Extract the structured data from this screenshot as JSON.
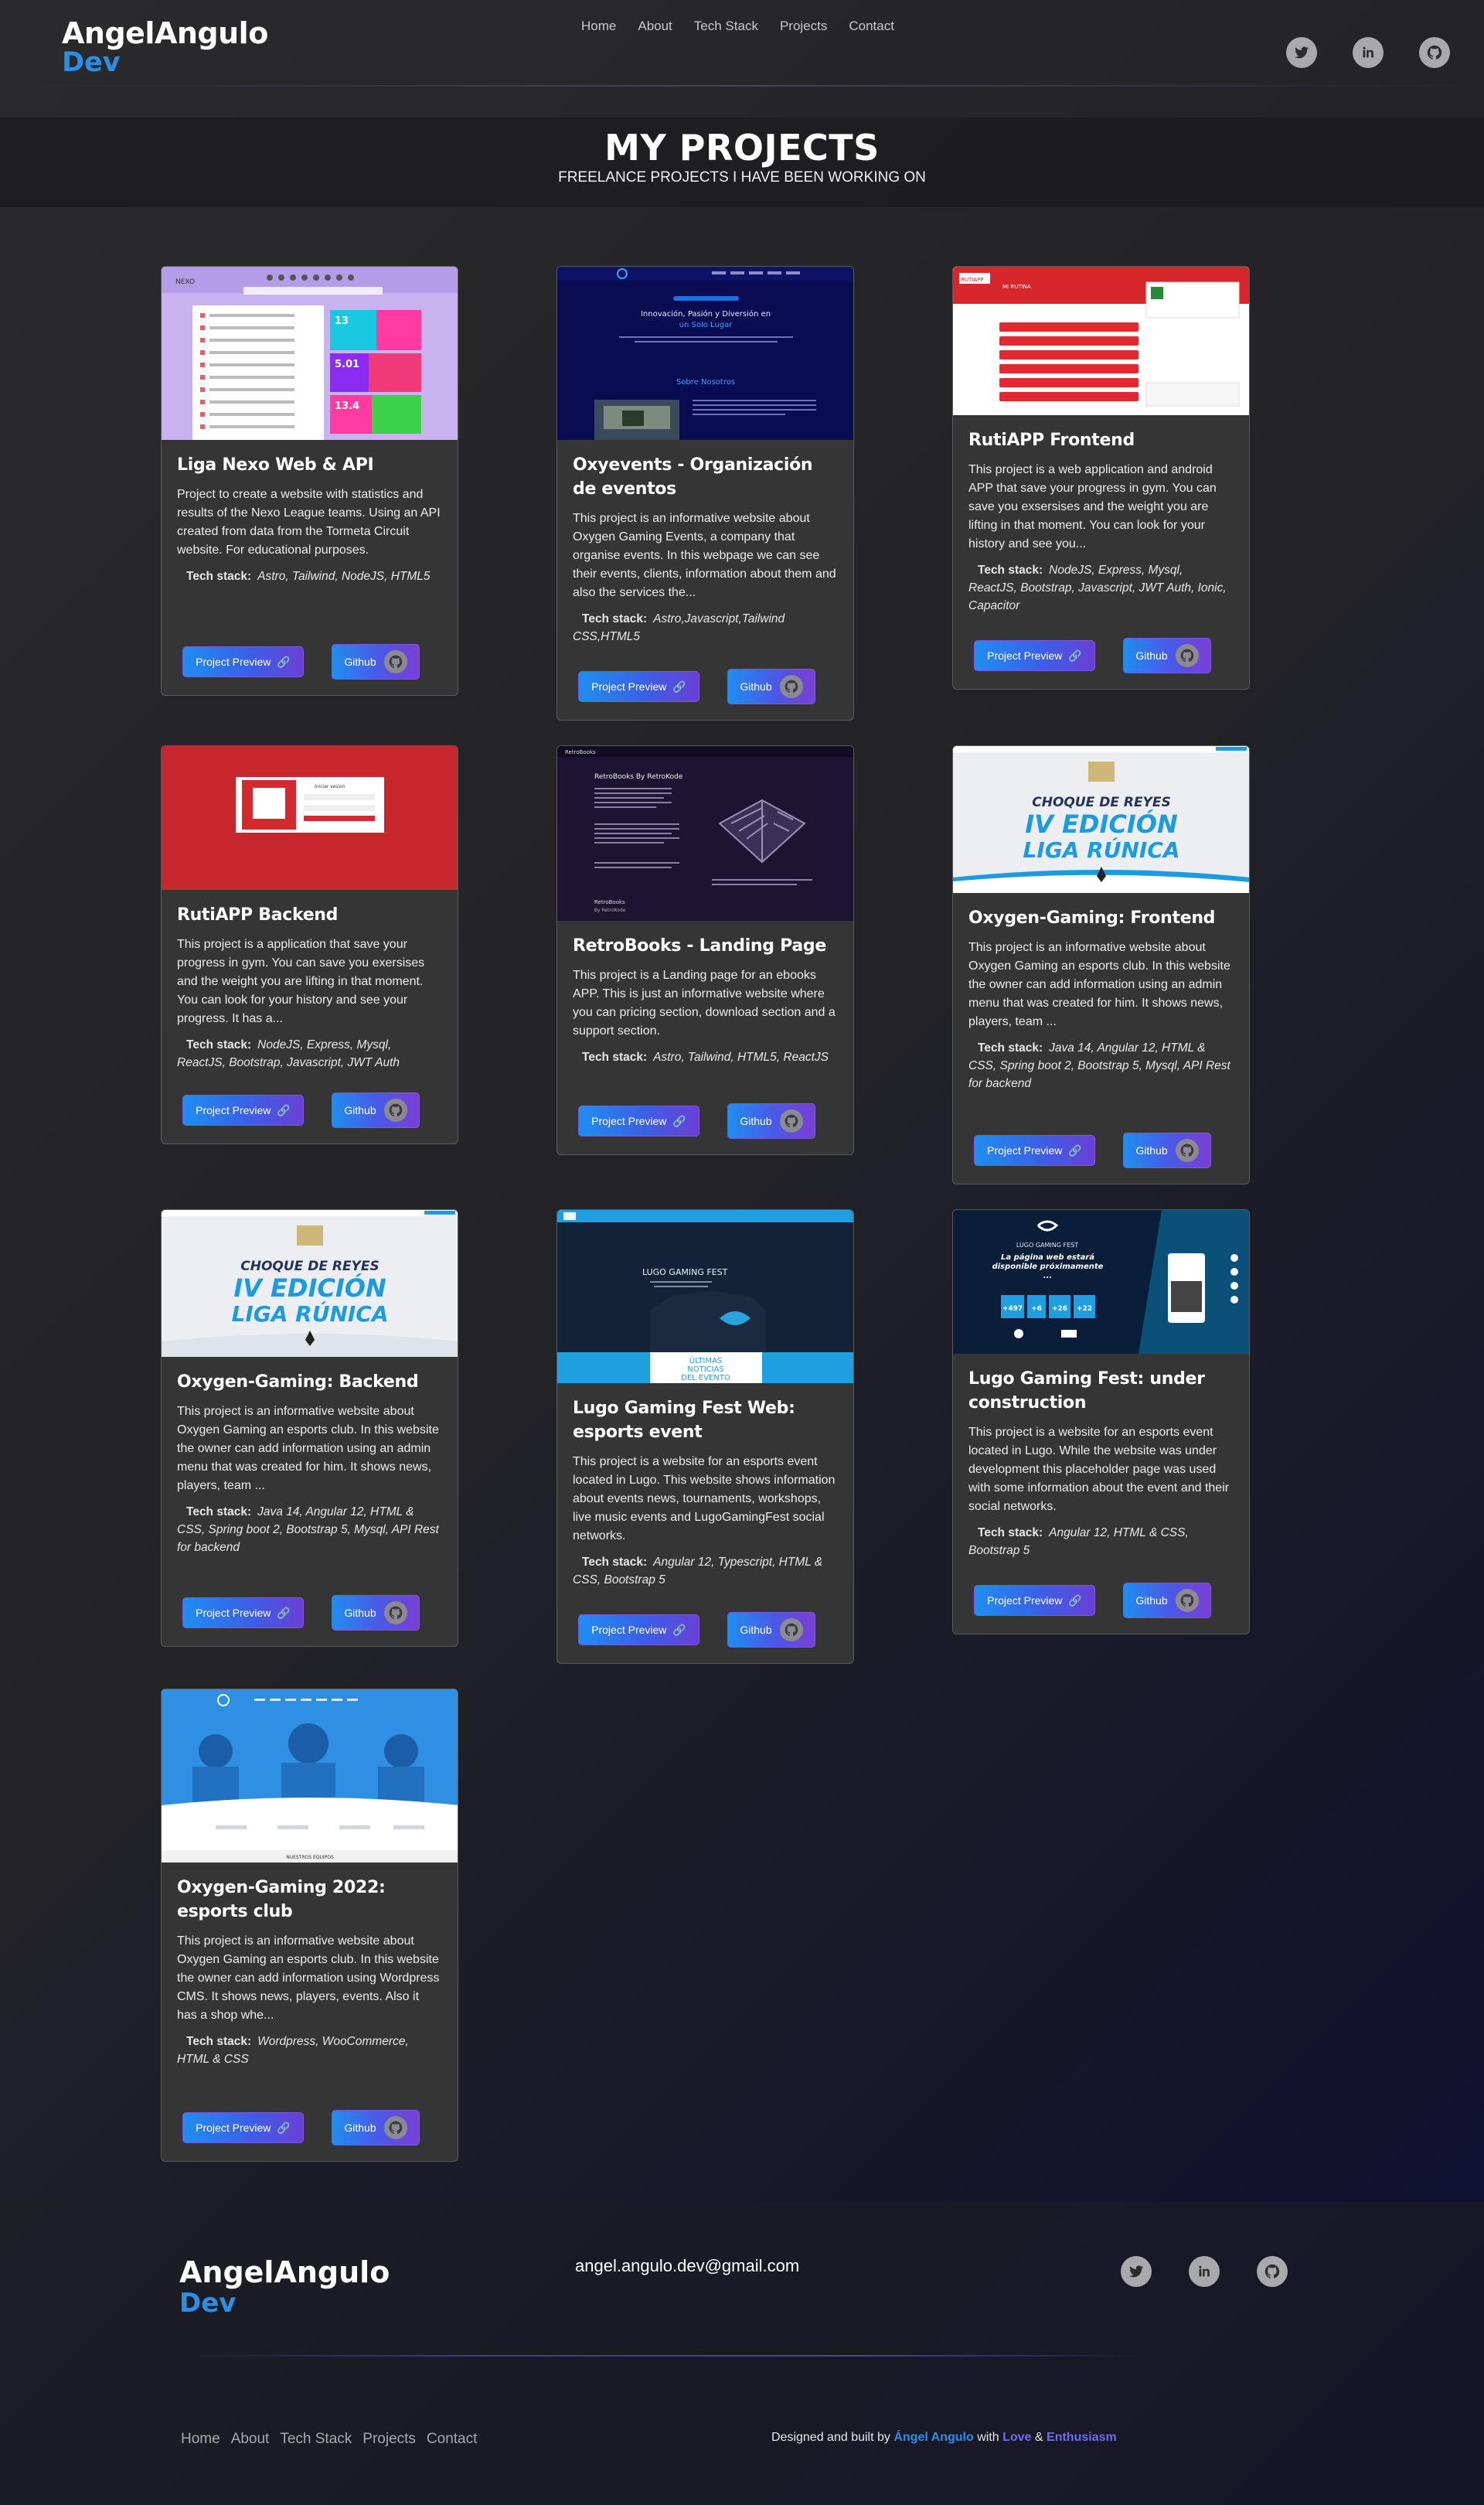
{
  "brand": {
    "first": "AngelAngulo",
    "second": "Dev"
  },
  "nav": {
    "items": [
      "Home",
      "About",
      "Tech Stack",
      "Projects",
      "Contact"
    ]
  },
  "social_icons": [
    "twitter-icon",
    "linkedin-icon",
    "github-icon"
  ],
  "section": {
    "title": "MY PROJECTS",
    "subtitle": "FREELANCE PROJECTS I HAVE BEEN WORKING ON"
  },
  "buttons": {
    "preview": "Project Preview",
    "github": "Github"
  },
  "tech_label": "Tech stack:",
  "projects": [
    {
      "title": "Liga Nexo Web & API",
      "description": "Project to create a website with statistics and results of the Nexo League teams. Using an API created from data from the Tormeta Circuit website. For educational purposes.",
      "stack": "Astro, Tailwind, NodeJS, HTML5"
    },
    {
      "title": "Oxyevents - Organización de eventos",
      "description": "This project is an informative website about Oxygen Gaming Events, a company that organise events. In this webpage we can see their events, clients, information about them and also the services the...",
      "stack": "Astro,Javascript,Tailwind CSS,HTML5"
    },
    {
      "title": "RutiAPP Frontend",
      "description": "This project is a web application and android APP that save your progress in gym. You can save you exsersises and the weight you are lifting in that moment. You can look for your history and see you...",
      "stack": "NodeJS, Express, Mysql, ReactJS, Bootstrap, Javascript, JWT Auth, Ionic, Capacitor"
    },
    {
      "title": "RutiAPP Backend",
      "description": "This project is a application that save your progress in gym. You can save you exersises and the weight you are lifting in that moment. You can look for your history and see your progress. It has a...",
      "stack": "NodeJS, Express, Mysql, ReactJS, Bootstrap, Javascript, JWT Auth"
    },
    {
      "title": "RetroBooks - Landing Page",
      "description": "This project is a Landing page for an ebooks APP. This is just an informative website where you can pricing section, download section and a support section.",
      "stack": "Astro, Tailwind, HTML5, ReactJS"
    },
    {
      "title": "Oxygen-Gaming: Frontend",
      "description": "This project is an informative website about Oxygen Gaming an esports club. In this website the owner can add information using an admin menu that was created for him. It shows news, players, team ...",
      "stack": "Java 14, Angular 12, HTML & CSS, Spring boot 2, Bootstrap 5, Mysql, API Rest for backend"
    },
    {
      "title": "Oxygen-Gaming: Backend",
      "description": "This project is an informative website about Oxygen Gaming an esports club. In this website the owner can add information using an admin menu that was created for him. It shows news, players, team ...",
      "stack": "Java 14, Angular 12, HTML & CSS, Spring boot 2, Bootstrap 5, Mysql, API Rest for backend"
    },
    {
      "title": "Lugo Gaming Fest Web: esports event",
      "description": "This project is a website for an esports event located in Lugo. This website shows information about events news, tournaments, workshops, live music events and LugoGamingFest social networks.",
      "stack": "Angular 12, Typescript, HTML & CSS, Bootstrap 5"
    },
    {
      "title": "Lugo Gaming Fest: under construction",
      "description": "This project is a website for an esports event located in Lugo. While the website was under development this placeholder page was used with some information about the event and their social networks.",
      "stack": "Angular 12, HTML & CSS, Bootstrap 5"
    },
    {
      "title": "Oxygen-Gaming 2022: esports club",
      "description": "This project is an informative website about Oxygen Gaming an esports club. In this website the owner can add information using Wordpress CMS. It shows news, players, events. Also it has a shop whe...",
      "stack": "Wordpress, WooCommerce, HTML & CSS"
    }
  ],
  "thumbnails": {
    "nexo": {
      "brand": "NEXO",
      "stats": [
        "13",
        "5.01",
        "13.4"
      ]
    },
    "oxyevents": {
      "headline": "Innovación, Pasión y Diversión en",
      "headline2": "un Solo Lugar",
      "section": "Sobre Nosotros"
    },
    "rutiapp_front": {
      "brand": "RUTIAPP",
      "header": "MI RUTINA"
    },
    "rutiapp_back": {
      "caption": "Iniciar sesion"
    },
    "retrobooks": {
      "brand": "RetroBooks",
      "title": "RetroBooks By RetroKode",
      "footer": "RetroBooks",
      "footer2": "By RetroKode"
    },
    "oxygen_event": {
      "line1": "CHOQUE DE REYES",
      "line2": "IV EDICIÓN",
      "line3": "LIGA RÚNICA"
    },
    "lugo": {
      "title": "LUGO GAMING FEST",
      "banner1": "ÚLTIMAS",
      "banner2": "NOTICIAS",
      "banner3": "DEL EVENTO"
    },
    "lugo_uc": {
      "title": "LUGO GAMING FEST",
      "msg": "La página web estará disponible próximamente ...",
      "counters": [
        "+497",
        "+6",
        "+26",
        "+22"
      ]
    },
    "oxygen2022": {
      "section": "NUESTROS EQUIPOS"
    }
  },
  "footer": {
    "email": "angel.angulo.dev@gmail.com",
    "nav": [
      "Home",
      "About",
      "Tech Stack",
      "Projects",
      "Contact"
    ],
    "credit_prefix": "Designed and built by",
    "credit_name": "Ángel Angulo",
    "credit_with": "with",
    "credit_love": "Love",
    "credit_amp": "&",
    "credit_enthusiasm": "Enthusiasm"
  },
  "colors": {
    "accent_blue": "#2b8fe8",
    "accent_violet": "#6d6cf0",
    "card_bg": "#353535"
  }
}
